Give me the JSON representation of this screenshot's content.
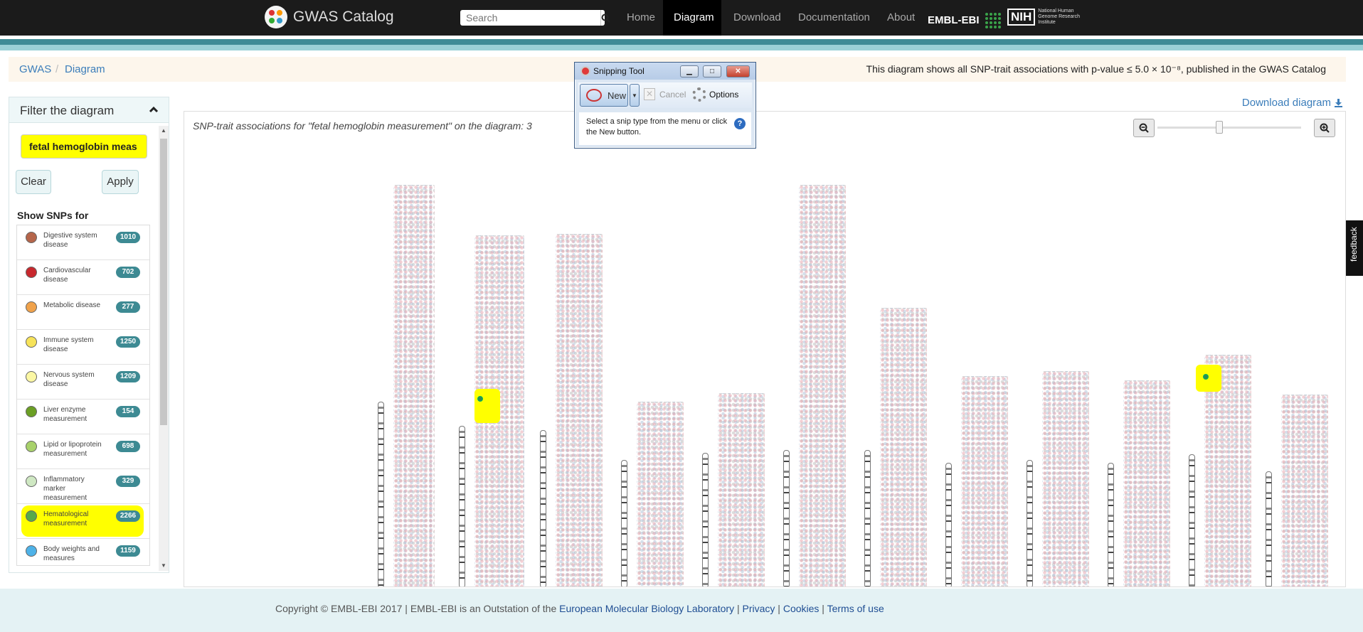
{
  "nav": {
    "brand": "GWAS Catalog",
    "search_placeholder": "Search",
    "home": "Home",
    "diagram": "Diagram",
    "download": "Download",
    "documentation": "Documentation",
    "about": "About",
    "embl_ebi": "EMBL-EBI",
    "nih": "NIH",
    "nih_text": "National Human Genome Research Institute"
  },
  "breadcrumb": {
    "root": "GWAS",
    "sep": "/",
    "current": "Diagram",
    "note": "This diagram shows all SNP-trait associations with p-value ≤ 5.0 × 10⁻⁸, published in the GWAS Catalog"
  },
  "filter": {
    "title": "Filter the diagram",
    "input_value": "fetal hemoglobin meas",
    "clear": "Clear",
    "apply": "Apply",
    "show_title": "Show SNPs for",
    "items": [
      {
        "label": "Digestive system disease",
        "count": "1010",
        "color": "#b5654a"
      },
      {
        "label": "Cardiovascular disease",
        "count": "702",
        "color": "#c8282d"
      },
      {
        "label": "Metabolic disease",
        "count": "277",
        "color": "#f0a24b"
      },
      {
        "label": "Immune system disease",
        "count": "1250",
        "color": "#f7e35a"
      },
      {
        "label": "Nervous system disease",
        "count": "1209",
        "color": "#fbf7a4"
      },
      {
        "label": "Liver enzyme measurement",
        "count": "154",
        "color": "#6b9f24"
      },
      {
        "label": "Lipid or lipoprotein measurement",
        "count": "698",
        "color": "#a8d16b"
      },
      {
        "label": "Inflammatory marker measurement",
        "count": "329",
        "color": "#cfe8c3"
      },
      {
        "label": "Hematological measurement",
        "count": "2266",
        "color": "#57a94b"
      },
      {
        "label": "Body weights and measures",
        "count": "1159",
        "color": "#4eb2e8"
      }
    ]
  },
  "diagram": {
    "download_label": "Download diagram",
    "caption": "SNP-trait associations for \"fetal hemoglobin measurement\" on the diagram: 3"
  },
  "snipping_tool": {
    "title": "Snipping Tool",
    "new": "New",
    "cancel": "Cancel",
    "options": "Options",
    "message": "Select a snip type from the menu or click the New button.",
    "help": "?"
  },
  "feedback": "feedback",
  "footer": {
    "prefix": "Copyright © EMBL-EBI 2017 | EMBL-EBI is an Outstation of the ",
    "embl": "European Molecular Biology Laboratory",
    "privacy": "Privacy",
    "cookies": "Cookies",
    "terms": "Terms of use",
    "sep": " | "
  },
  "colors": {
    "nav_bg": "#1b1b1b",
    "accent_teal": "#3e8c96",
    "badge": "#3d8a93",
    "highlight": "#ffff00",
    "link": "#3b7dba"
  }
}
